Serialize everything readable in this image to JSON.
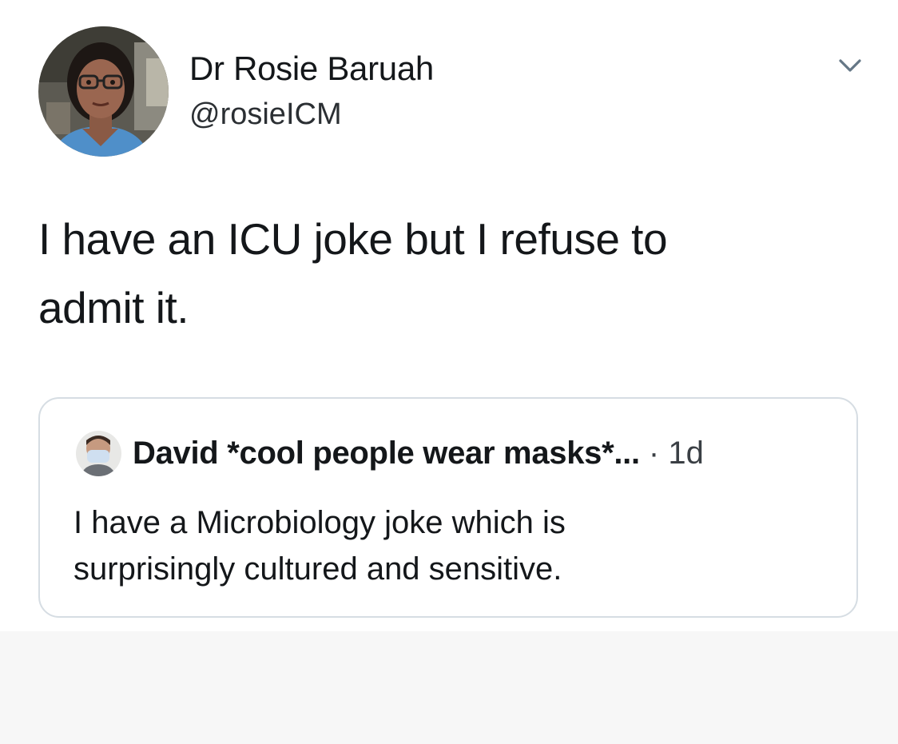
{
  "tweet": {
    "author": {
      "display_name": "Dr Rosie Baruah",
      "handle": "@rosieICM"
    },
    "text_line1": "I have an ICU joke but I refuse to",
    "text_line2": "admit it."
  },
  "quoted_tweet": {
    "author_name": "David *cool people wear masks*...",
    "time_separator": " · ",
    "time": "1d",
    "text_line1": "I have a Microbiology joke which is",
    "text_line2": "surprisingly cultured and sensitive."
  },
  "icons": {
    "more": "chevron-down-icon"
  },
  "colors": {
    "text_primary": "#14171a",
    "text_secondary": "#3a3f44",
    "card_border": "#d6dde3"
  }
}
